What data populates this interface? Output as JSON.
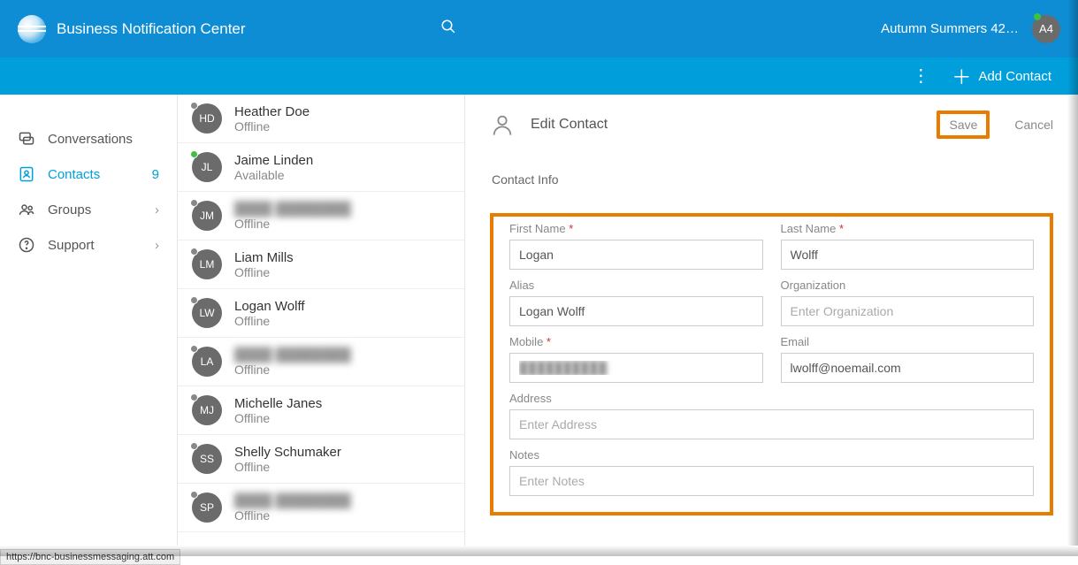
{
  "header": {
    "app_title": "Business Notification Center",
    "user_display": "Autumn Summers 42…",
    "avatar_initials": "A4"
  },
  "subheader": {
    "add_contact_label": "Add Contact"
  },
  "sidebar": {
    "items": [
      {
        "label": "Conversations",
        "icon": "chat-icon"
      },
      {
        "label": "Contacts",
        "icon": "contacts-icon",
        "count": "9",
        "active": true
      },
      {
        "label": "Groups",
        "icon": "groups-icon",
        "chevron": true
      },
      {
        "label": "Support",
        "icon": "support-icon",
        "chevron": true
      }
    ]
  },
  "contacts": [
    {
      "initials": "HD",
      "name": "Heather Doe",
      "status": "Offline",
      "presence": "offline"
    },
    {
      "initials": "JL",
      "name": "Jaime Linden",
      "status": "Available",
      "presence": "online"
    },
    {
      "initials": "JM",
      "name": "████ ████████",
      "status": "Offline",
      "presence": "offline",
      "blurred": true
    },
    {
      "initials": "LM",
      "name": "Liam Mills",
      "status": "Offline",
      "presence": "offline"
    },
    {
      "initials": "LW",
      "name": "Logan Wolff",
      "status": "Offline",
      "presence": "offline"
    },
    {
      "initials": "LA",
      "name": "████ ████████",
      "status": "Offline",
      "presence": "offline",
      "blurred": true
    },
    {
      "initials": "MJ",
      "name": "Michelle Janes",
      "status": "Offline",
      "presence": "offline"
    },
    {
      "initials": "SS",
      "name": "Shelly Schumaker",
      "status": "Offline",
      "presence": "offline"
    },
    {
      "initials": "SP",
      "name": "████ ████████",
      "status": "Offline",
      "presence": "offline",
      "blurred": true
    }
  ],
  "edit_panel": {
    "title": "Edit Contact",
    "save_label": "Save",
    "cancel_label": "Cancel",
    "section_title": "Contact Info",
    "fields": {
      "first_name": {
        "label": "First Name",
        "value": "Logan",
        "required": true
      },
      "last_name": {
        "label": "Last Name",
        "value": "Wolff",
        "required": true
      },
      "alias": {
        "label": "Alias",
        "value": "Logan Wolff"
      },
      "organization": {
        "label": "Organization",
        "value": "",
        "placeholder": "Enter Organization"
      },
      "mobile": {
        "label": "Mobile",
        "value": "██████████",
        "required": true,
        "blurred": true
      },
      "email": {
        "label": "Email",
        "value": "lwolff@noemail.com"
      },
      "address": {
        "label": "Address",
        "value": "",
        "placeholder": "Enter Address"
      },
      "notes": {
        "label": "Notes",
        "value": "",
        "placeholder": "Enter Notes"
      }
    }
  },
  "statusbar": {
    "text": "https://bnc-businessmessaging.att.com"
  }
}
